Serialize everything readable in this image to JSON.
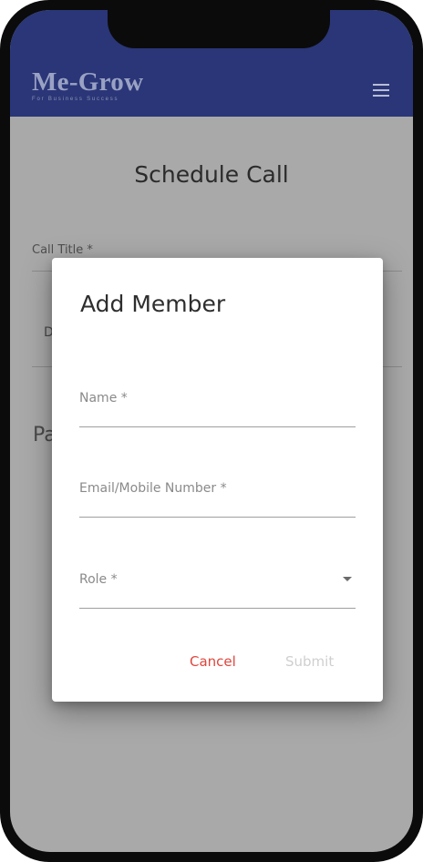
{
  "app": {
    "brand_name": "Me-Grow",
    "brand_tagline": "For Business Success",
    "menu_icon": "hamburger-menu-icon"
  },
  "page": {
    "title": "Schedule Call",
    "call_title_label": "Call Title *",
    "partial_field_text": "D",
    "partial_section_text": "Pa"
  },
  "dialog": {
    "title": "Add Member",
    "fields": {
      "name": {
        "label": "Name *",
        "value": ""
      },
      "contact": {
        "label": "Email/Mobile Number *",
        "value": ""
      },
      "role": {
        "label": "Role *",
        "value": "",
        "icon": "dropdown-caret-icon"
      }
    },
    "cancel_label": "Cancel",
    "submit_label": "Submit"
  },
  "colors": {
    "appbar": "#2a3677",
    "accent_cancel": "#e0463c",
    "disabled_submit": "#cfcfcf",
    "scrim": "#a9a9a9"
  }
}
